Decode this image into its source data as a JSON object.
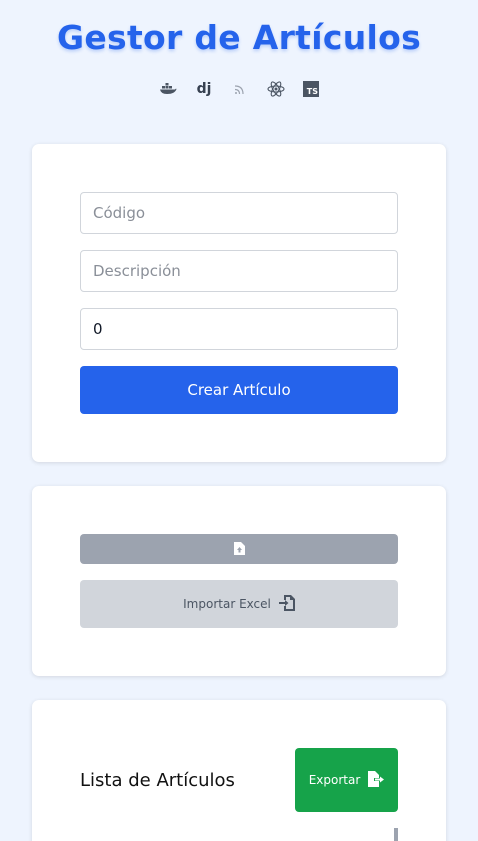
{
  "header": {
    "title": "Gestor de Artículos",
    "tech_icons": [
      "docker-icon",
      "django-icon",
      "rss-icon",
      "react-icon",
      "typescript-icon"
    ],
    "django_label": "dj",
    "ts_label": "TS"
  },
  "form": {
    "codigo_placeholder": "Código",
    "descripcion_placeholder": "Descripción",
    "cantidad_value": "0",
    "create_label": "Crear Artículo"
  },
  "import": {
    "file_icon": "file-upload-icon",
    "import_label": "Importar Excel",
    "import_icon": "file-import-icon"
  },
  "list": {
    "title": "Lista de Artículos",
    "export_label": "Exportar",
    "export_icon": "file-export-icon"
  },
  "colors": {
    "primary": "#2563eb",
    "export_green": "#16a34a",
    "background": "#eef4fe",
    "disabled_gray": "#d1d5db"
  }
}
